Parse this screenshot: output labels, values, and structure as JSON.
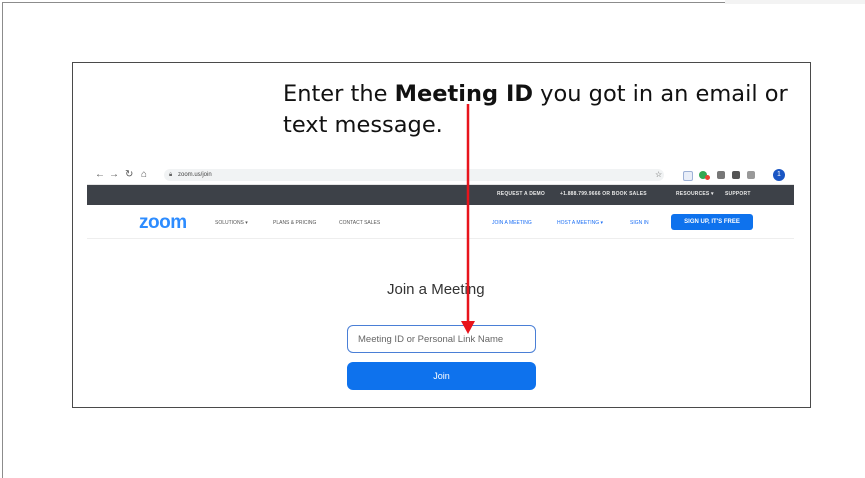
{
  "caption": {
    "prefix": "Enter the ",
    "bold": "Meeting ID",
    "suffix": " you got in an email or text message."
  },
  "browser": {
    "url": "zoom.us/join",
    "topbar": {
      "request_demo": "REQUEST A DEMO",
      "phone": "+1.888.799.9666 OR BOOK SALES",
      "resources": "RESOURCES ▾",
      "support": "SUPPORT"
    },
    "nav": {
      "logo": "zoom",
      "solutions": "SOLUTIONS ▾",
      "plans": "PLANS & PRICING",
      "contact": "CONTACT SALES",
      "join_meeting": "JOIN A MEETING",
      "host_meeting": "HOST A MEETING ▾",
      "sign_in": "SIGN IN",
      "signup": "SIGN UP, IT'S FREE"
    },
    "join": {
      "title": "Join a Meeting",
      "input_placeholder": "Meeting ID or Personal Link Name",
      "button": "Join"
    }
  },
  "colors": {
    "zoom_blue": "#0e72ed",
    "arrow_red": "#e8141c",
    "topbar_bg": "#3d4148"
  }
}
